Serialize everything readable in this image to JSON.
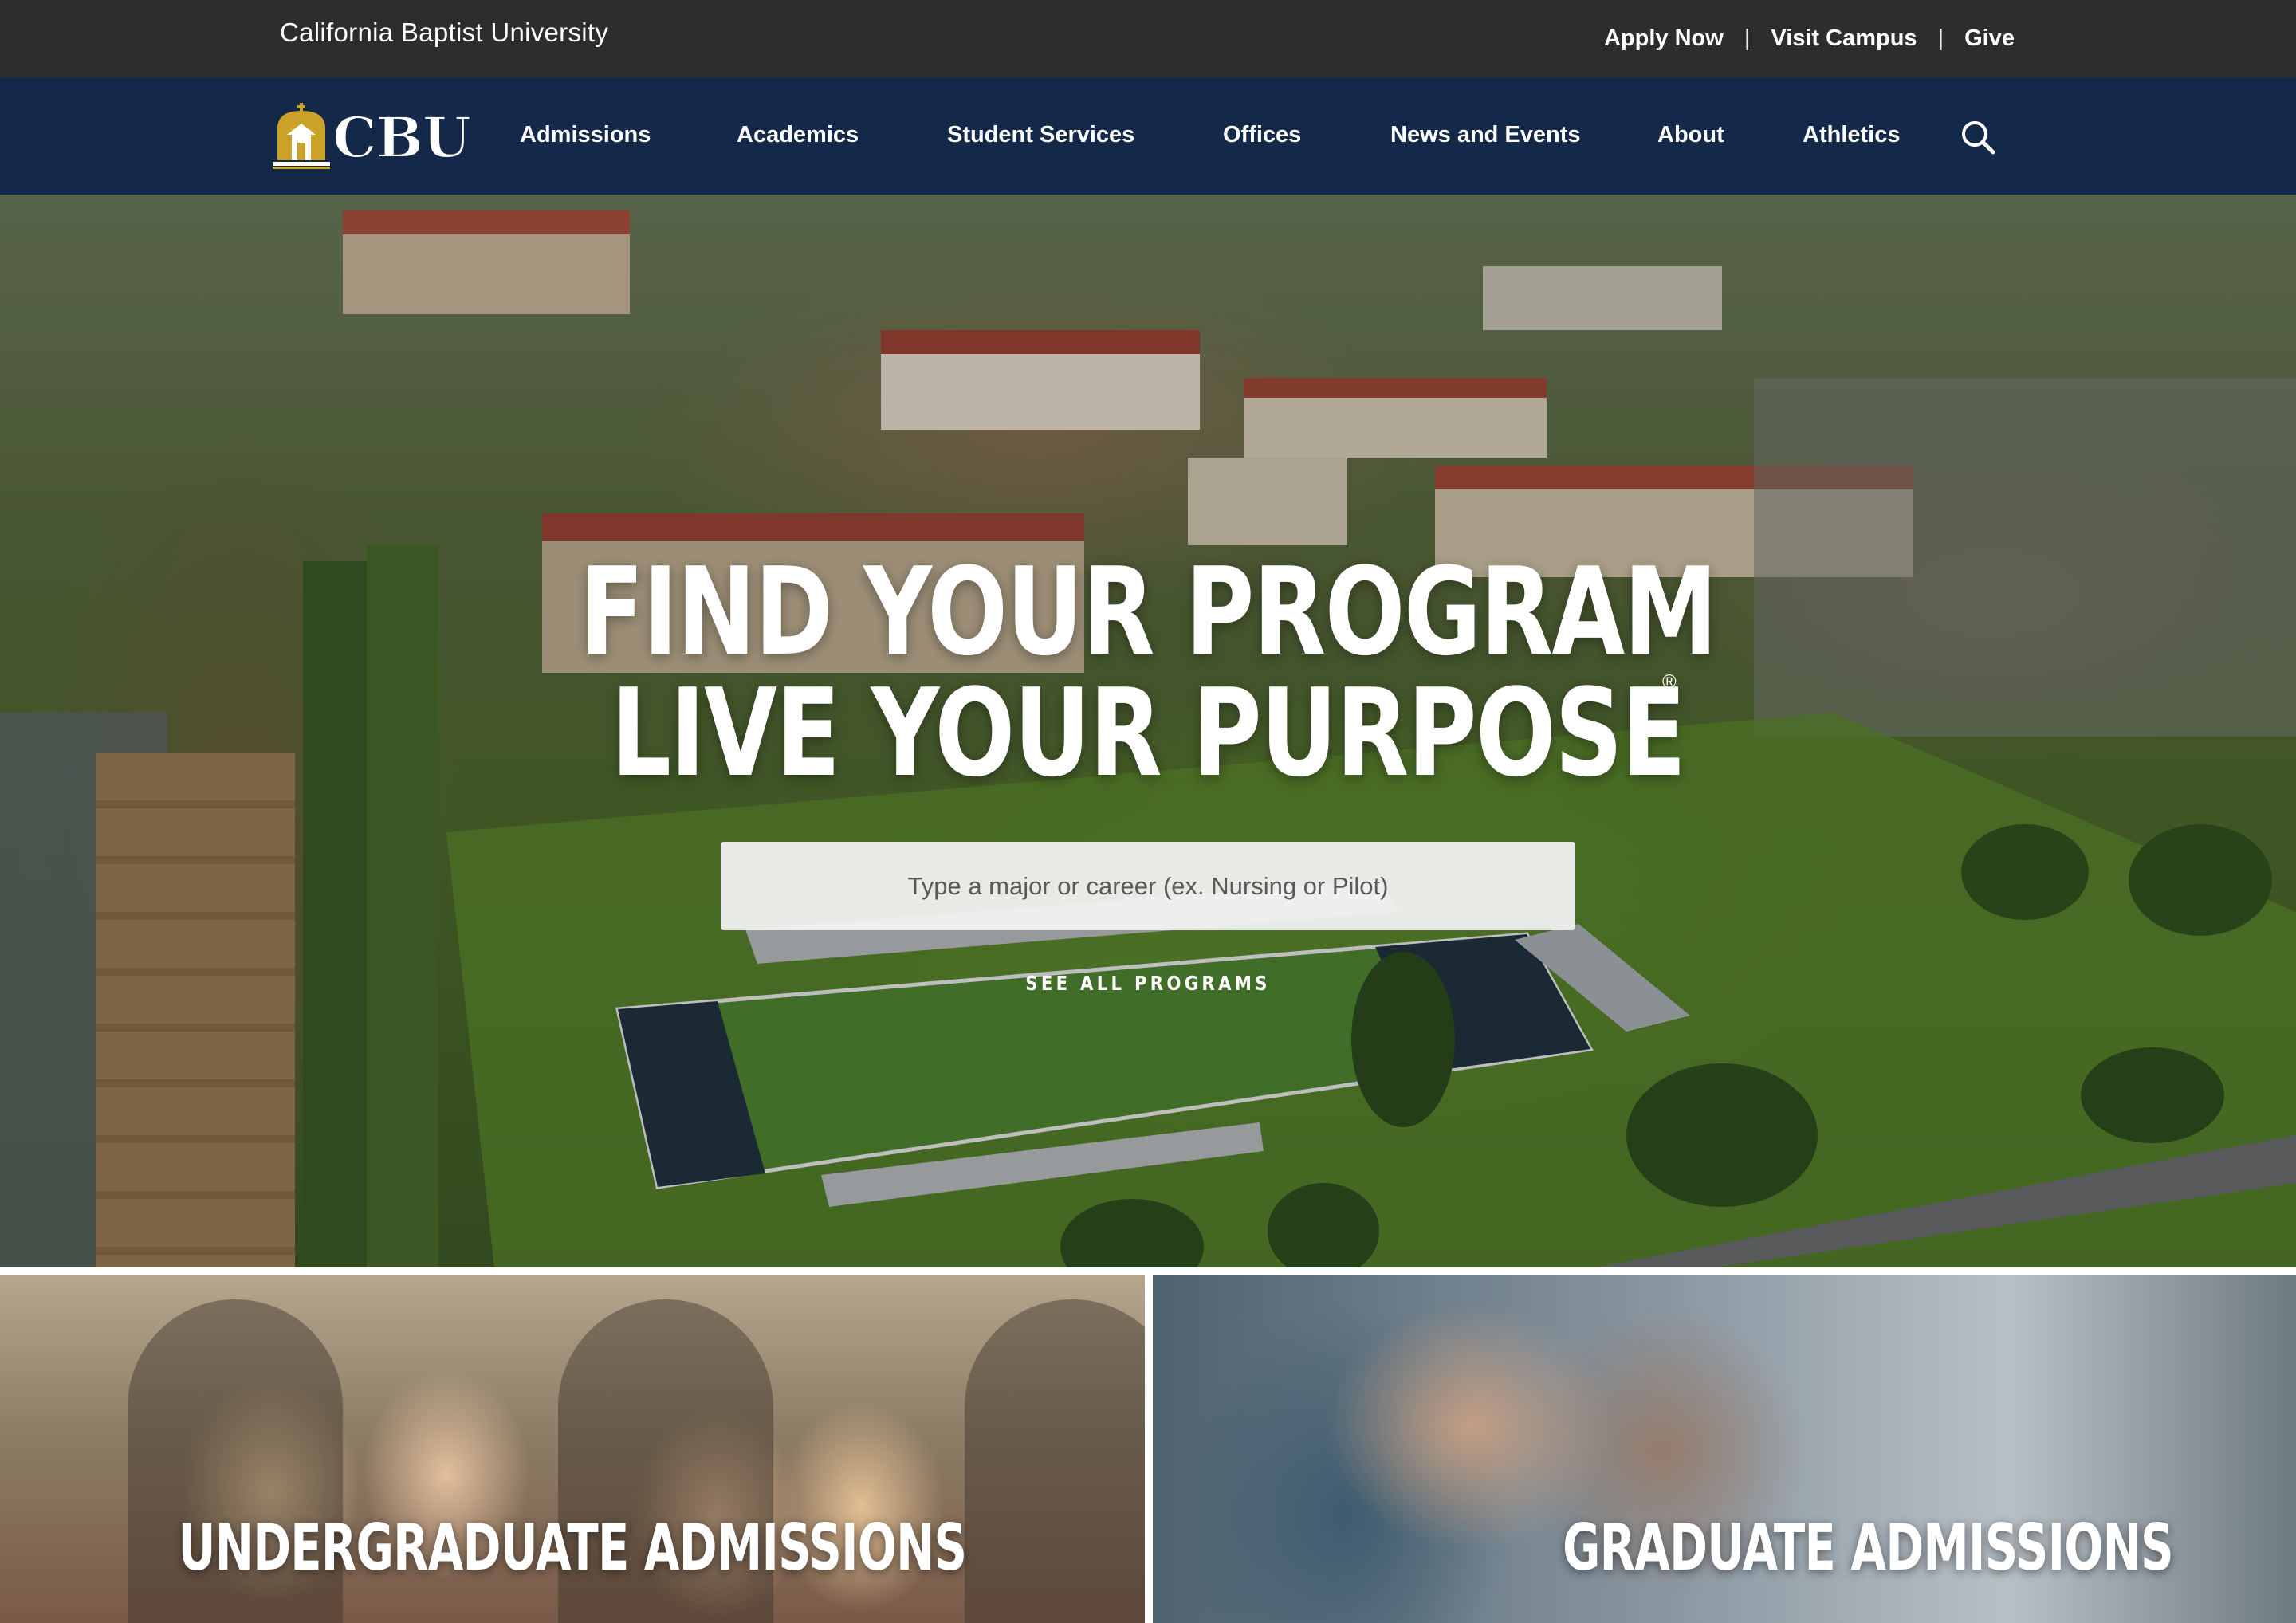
{
  "utility": {
    "site_name": "California Baptist University",
    "links": [
      "Apply Now",
      "Visit Campus",
      "Give"
    ],
    "separator": "|"
  },
  "nav": {
    "logo_text": "CBU",
    "items": [
      "Admissions",
      "Academics",
      "Student Services",
      "Offices",
      "News and Events",
      "About",
      "Athletics"
    ],
    "search_icon": "search-icon"
  },
  "hero": {
    "line_1": "FIND YOUR PROGRAM",
    "line_2": "LIVE YOUR PURPOSE",
    "reg_mark": "®",
    "search_placeholder": "Type a major or career (ex. Nursing or Pilot)",
    "see_all": "SEE ALL PROGRAMS"
  },
  "tiles": {
    "undergraduate": "UNDERGRADUATE ADMISSIONS",
    "graduate": "GRADUATE ADMISSIONS"
  },
  "colors": {
    "utility_bg": "#2d2d2e",
    "nav_bg": "#14284a",
    "logo_gold": "#c9a227",
    "text": "#ffffff"
  }
}
